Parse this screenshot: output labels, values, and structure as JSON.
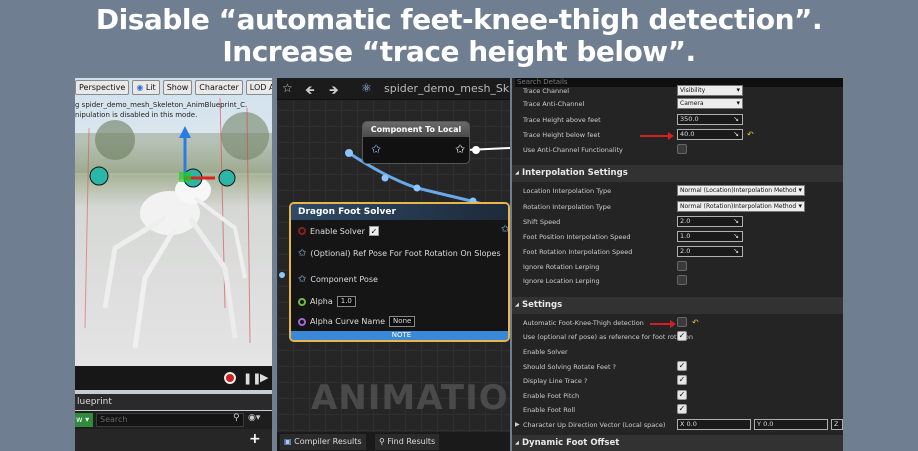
{
  "headline": {
    "line1": "Disable “automatic feet-knee-thigh detection”.",
    "line2": "Increase “trace height below”."
  },
  "viewport": {
    "toolbar": [
      "Perspective",
      "Lit",
      "Show",
      "Character",
      "LOD Auto"
    ],
    "message_line1": "g spider_demo_mesh_Skeleton_AnimBlueprint_C.",
    "message_line2": "nipulation is disabled in this mode.",
    "blueprint_tab": "lueprint",
    "view_label": "w",
    "search_placeholder": "Search"
  },
  "graph": {
    "title": "spider_demo_mesh_Sk",
    "component_node_title": "Component To Local",
    "dfs_node": {
      "title": "Dragon Foot Solver",
      "enable_solver": "Enable Solver",
      "ref_pose": "(Optional) Ref Pose For Foot Rotation On Slopes",
      "component_pose": "Component Pose",
      "alpha_label": "Alpha",
      "alpha_value": "1.0",
      "alpha_curve_label": "Alpha Curve Name",
      "alpha_curve_value": "None",
      "note": "NOTE"
    },
    "watermark": "ANIMATION",
    "tabs": [
      "Compiler Results",
      "Find Results"
    ]
  },
  "details": {
    "search_placeholder": "Search Details",
    "rows_top": [
      {
        "label": "Trace Channel",
        "value": "Visibility",
        "kind": "dropdown"
      },
      {
        "label": "Trace Anti-Channel",
        "value": "Camera",
        "kind": "dropdown"
      },
      {
        "label": "Trace Height above feet",
        "value": "350.0",
        "kind": "number"
      },
      {
        "label": "Trace Height below feet",
        "value": "40.0",
        "kind": "number"
      },
      {
        "label": "Use Anti-Channel Functionality",
        "value": "",
        "kind": "checkbox"
      }
    ],
    "sections": {
      "interp": "Interpolation Settings",
      "settings": "Settings",
      "dynamic": "Dynamic Foot Offset"
    },
    "interp_rows": [
      {
        "label": "Location Interpolation Type",
        "value": "Normal (Location)Interpolation Method",
        "kind": "dropdown"
      },
      {
        "label": "Rotation Interpolation Type",
        "value": "Normal (Rotation)Interpolation Method",
        "kind": "dropdown"
      },
      {
        "label": "Shift Speed",
        "value": "2.0",
        "kind": "number"
      },
      {
        "label": "Foot Position Interpolation Speed",
        "value": "1.0",
        "kind": "number"
      },
      {
        "label": "Foot Rotation Interpolation Speed",
        "value": "2.0",
        "kind": "number"
      },
      {
        "label": "Ignore Rotation Lerping",
        "value": "",
        "kind": "checkbox"
      },
      {
        "label": "Ignore Location Lerping",
        "value": "",
        "kind": "checkbox"
      }
    ],
    "settings_rows": [
      {
        "label": "Automatic Foot-Knee-Thigh detection",
        "checked": false
      },
      {
        "label": "Use (optional ref pose) as reference for foot rotation",
        "checked": true
      },
      {
        "label": "Enable Solver",
        "checked": null
      },
      {
        "label": "Should Solving Rotate Feet ?",
        "checked": true
      },
      {
        "label": "Display Line Trace ?",
        "checked": true
      },
      {
        "label": "Enable Foot Pitch",
        "checked": true
      },
      {
        "label": "Enable Foot Roll",
        "checked": true
      }
    ],
    "vector_row": {
      "label": "Character Up Direction Vector (Local space)",
      "x_label": "X",
      "x_value": "0.0",
      "y_label": "Y",
      "y_value": "0.0",
      "z_label": "Z"
    }
  },
  "colors": {
    "background": "#6f7f91",
    "annotation_arrow": "#d02020",
    "node_border": "#e8b64a",
    "note_bar": "#3a88d8"
  }
}
